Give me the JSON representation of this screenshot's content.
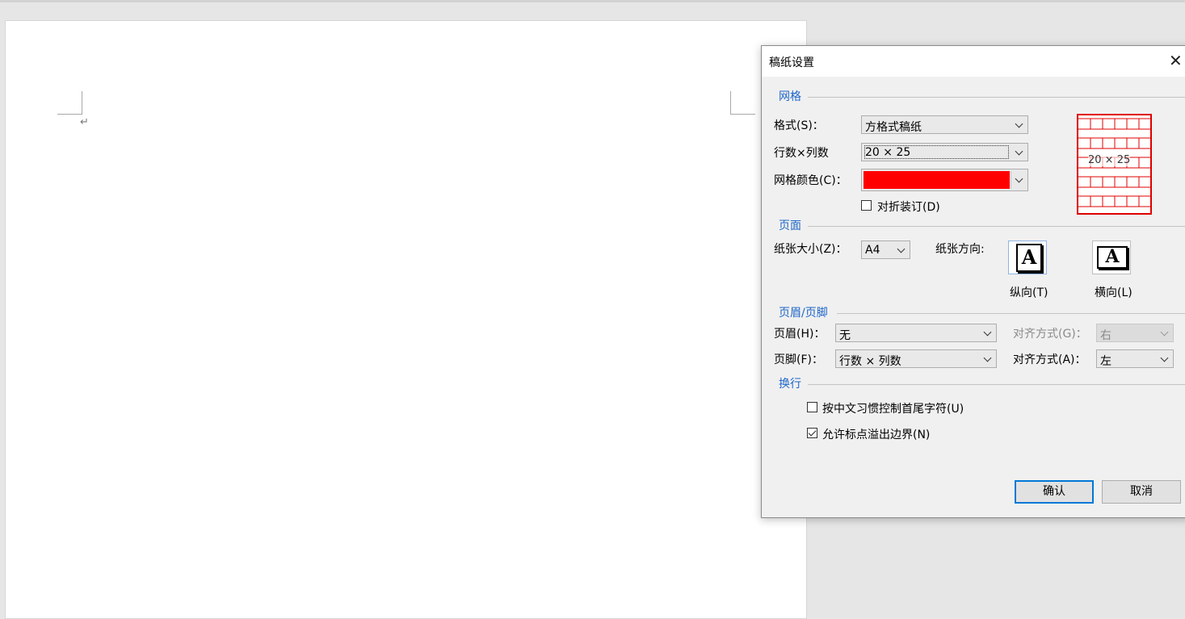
{
  "dialog": {
    "title": "稿纸设置",
    "close_symbol": "✕"
  },
  "grid_section": {
    "header": "网格",
    "format_label": "格式(S)：",
    "format_value": "方格式稿纸",
    "rows_cols_label": "行数×列数",
    "rows_cols_value": "20 × 25",
    "color_label": "网格颜色(C)：",
    "color_value": "#ff0000",
    "fold_binding_label": "对折装订(D)",
    "fold_binding_checked": false,
    "preview_text": "20 × 25",
    "preview_color": "#e00000"
  },
  "page_section": {
    "header": "页面",
    "paper_size_label": "纸张大小(Z)：",
    "paper_size_value": "A4",
    "orientation_label": "纸张方向:",
    "portrait_label": "纵向(T)",
    "landscape_label": "横向(L)",
    "icon_letter": "A",
    "selected_orientation": "portrait"
  },
  "header_footer_section": {
    "header": "页眉/页脚",
    "header_label": "页眉(H)：",
    "header_value": "无",
    "header_align_label": "对齐方式(G)：",
    "header_align_value": "右",
    "header_align_disabled": true,
    "footer_label": "页脚(F)：",
    "footer_value": "行数 × 列数",
    "footer_align_label": "对齐方式(A)：",
    "footer_align_value": "左"
  },
  "line_break_section": {
    "header": "换行",
    "chinese_rule_label": "按中文习惯控制首尾字符(U)",
    "chinese_rule_checked": false,
    "punct_overflow_label": "允许标点溢出边界(N)",
    "punct_overflow_checked": true
  },
  "buttons": {
    "ok": "确认",
    "cancel": "取消"
  },
  "document": {
    "paragraph_mark": "↵"
  },
  "colors": {
    "accent": "#1e66c8",
    "default_button_border": "#0078d7"
  }
}
